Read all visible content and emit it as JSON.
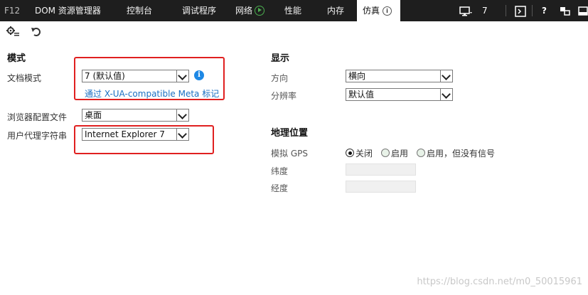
{
  "tabs": {
    "f12": "F12",
    "dom": "DOM 资源管理器",
    "console": "控制台",
    "debugger": "调试程序",
    "network": "网络",
    "performance": "性能",
    "memory": "内存",
    "emulation": "仿真"
  },
  "right_controls": {
    "target_count": "7",
    "help": "?"
  },
  "mode": {
    "heading": "模式",
    "doc_mode_label": "文档模式",
    "doc_mode_value": "7 (默认值)",
    "xua_link": "通过 X-UA-compatible Meta 标记",
    "browser_profile_label": "浏览器配置文件",
    "browser_profile_value": "桌面",
    "user_agent_label": "用户代理字符串",
    "user_agent_value": "Internet Explorer 7"
  },
  "display": {
    "heading": "显示",
    "orientation_label": "方向",
    "orientation_value": "横向",
    "resolution_label": "分辨率",
    "resolution_value": "默认值"
  },
  "geo": {
    "heading": "地理位置",
    "simulate_gps_label": "模拟 GPS",
    "options": [
      "关闭",
      "启用",
      "启用，但没有信号"
    ],
    "selected_option": "关闭",
    "latitude_label": "纬度",
    "longitude_label": "经度"
  },
  "watermark": "https://blog.csdn.net/m0_50015961",
  "colors": {
    "topbar": "#1e1e1e",
    "highlight_box": "#e02020",
    "link": "#1a6fc2",
    "info_icon": "#1e88e5"
  }
}
